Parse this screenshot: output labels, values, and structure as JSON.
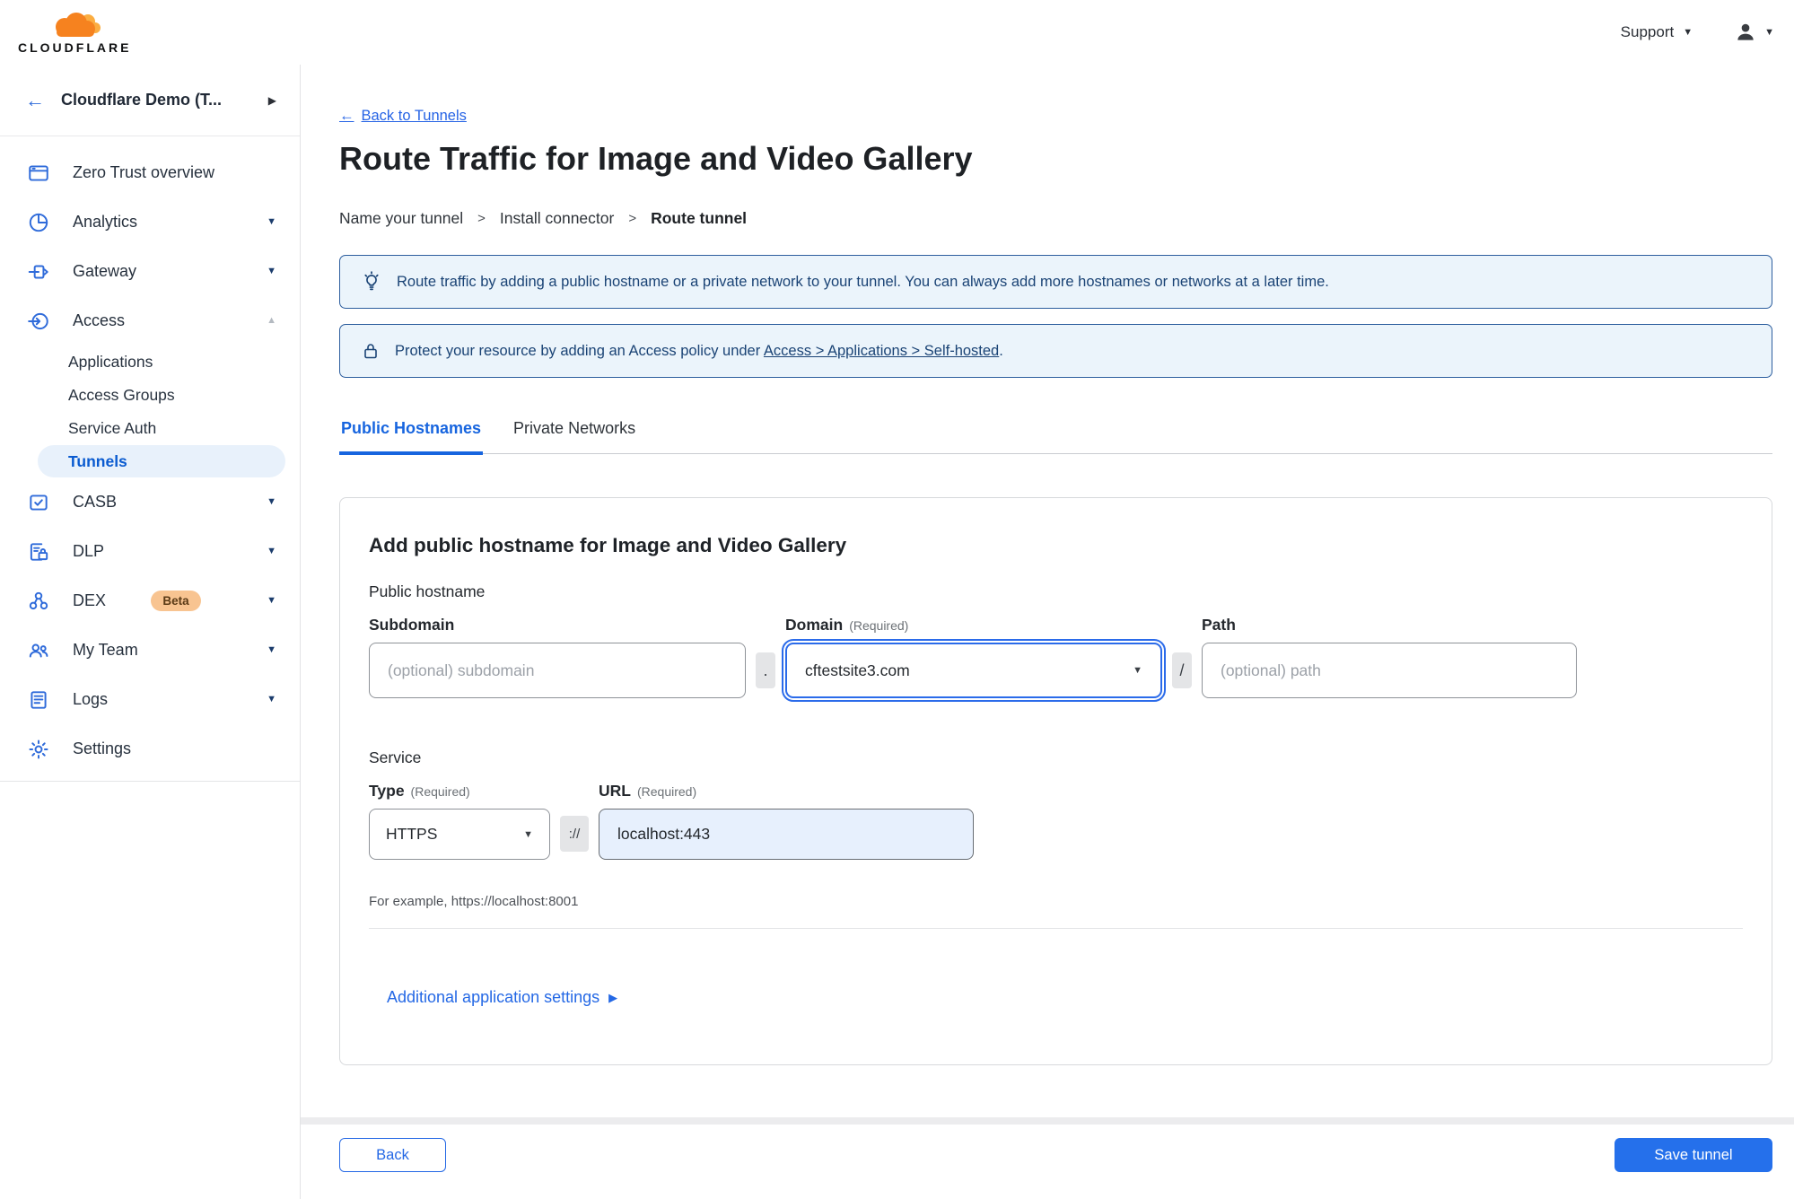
{
  "brand": {
    "wordmark": "CLOUDFLARE"
  },
  "topbar": {
    "support_label": "Support"
  },
  "icons": {
    "back_arrow": "←",
    "chevron_down": "▼",
    "chevron_up": "▲",
    "triangle_right": "▶",
    "breadcrumb_separator": ">"
  },
  "colors": {
    "brand_orange": "#F6821F",
    "brand_orange_light": "#FBAD41",
    "accent_blue": "#2570EB",
    "link_blue": "#2563E5",
    "tab_active_blue": "#1765DF",
    "sidebar_icon_blue": "#2F6BDA",
    "active_pill_bg": "#E8F1FB",
    "active_pill_text": "#0A5BD0",
    "banner_bg": "#EBF4FB",
    "banner_border": "#2D5E9E",
    "banner_text": "#1A4375",
    "beta_badge_bg": "#F8C491",
    "url_field_bg": "#E7F0FD"
  },
  "sidebar": {
    "account_name": "Cloudflare Demo (T...",
    "items": [
      {
        "label": "Zero Trust overview"
      },
      {
        "label": "Analytics"
      },
      {
        "label": "Gateway"
      },
      {
        "label": "Access",
        "children": [
          "Applications",
          "Access Groups",
          "Service Auth",
          "Tunnels"
        ],
        "active_child": "Tunnels"
      },
      {
        "label": "CASB"
      },
      {
        "label": "DLP"
      },
      {
        "label": "DEX",
        "badge": "Beta"
      },
      {
        "label": "My Team"
      },
      {
        "label": "Logs"
      },
      {
        "label": "Settings"
      }
    ]
  },
  "main": {
    "back_link_label": "Back to Tunnels",
    "title": "Route Traffic for Image and Video Gallery",
    "breadcrumb": {
      "step1": "Name your tunnel",
      "step2": "Install connector",
      "step3": "Route tunnel"
    },
    "banners": {
      "tip_text": "Route traffic by adding a public hostname or a private network to your tunnel. You can always add more hostnames or networks at a later time.",
      "policy_prefix": "Protect your resource by adding an Access policy under",
      "policy_link": "Access > Applications > Self-hosted",
      "policy_suffix": "."
    },
    "tabs": {
      "public": "Public Hostnames",
      "private": "Private Networks"
    },
    "form": {
      "heading": "Add public hostname for Image and Video Gallery",
      "public_hostname_label": "Public hostname",
      "subdomain_label": "Subdomain",
      "subdomain_placeholder": "(optional) subdomain",
      "dot_separator": ".",
      "domain_label": "Domain",
      "domain_required": "(Required)",
      "domain_value": "cftestsite3.com",
      "slash_separator": "/",
      "path_label": "Path",
      "path_placeholder": "(optional) path",
      "service_label": "Service",
      "type_label": "Type",
      "type_required": "(Required)",
      "type_value": "HTTPS",
      "scheme_separator": "://",
      "url_label": "URL",
      "url_required": "(Required)",
      "url_value": "localhost:443",
      "example_text": "For example, https://localhost:8001",
      "additional_settings_label": "Additional application settings"
    },
    "footer": {
      "back_label": "Back",
      "save_label": "Save tunnel"
    }
  }
}
